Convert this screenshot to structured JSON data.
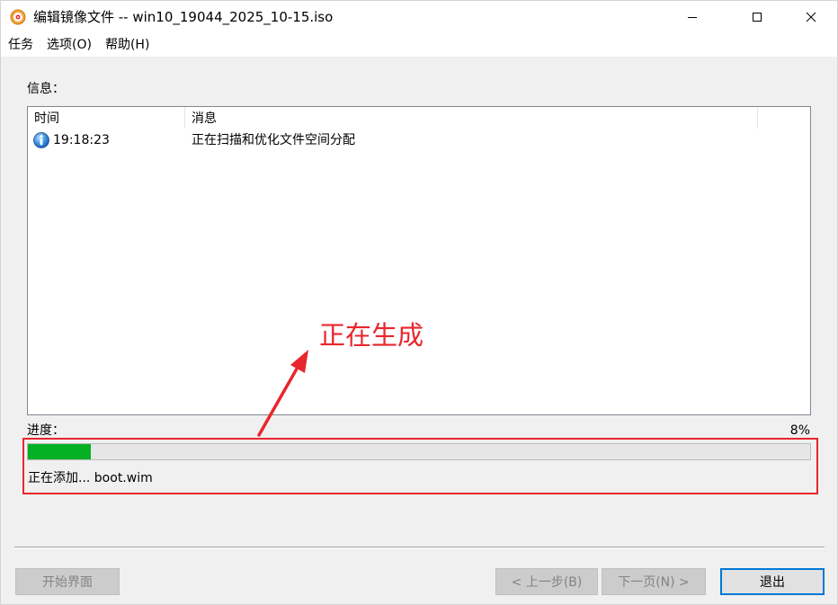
{
  "window": {
    "title": "编辑镜像文件 -- win10_19044_2025_10-15.iso",
    "icon": "disc-icon"
  },
  "menu": [
    {
      "label": "任务"
    },
    {
      "label": "选项(O)"
    },
    {
      "label": "帮助(H)"
    }
  ],
  "info": {
    "label": "信息：",
    "columns": [
      "时间",
      "消息"
    ],
    "rows": [
      {
        "icon": "info-icon",
        "time": "19:18:23",
        "message": "正在扫描和优化文件空间分配"
      }
    ]
  },
  "annotation": {
    "text": "正在生成",
    "color": "#e8262d"
  },
  "progress": {
    "label": "进度：",
    "percent_text": "8%",
    "value": 0.08,
    "bar_color": "#06b025",
    "status": "正在添加...  boot.wim"
  },
  "buttons": {
    "start": "开始界面",
    "prev": "< 上一步(B)",
    "next": "下一页(N) >",
    "exit": "退出"
  }
}
